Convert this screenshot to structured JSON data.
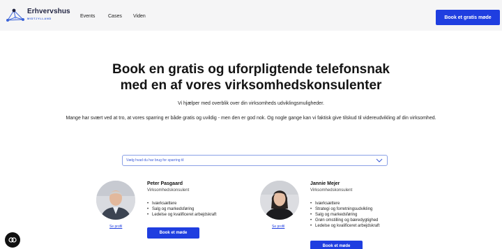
{
  "header": {
    "logo_title": "Erhvervshus",
    "logo_subtitle": "MIDTJYLLAND",
    "nav": [
      {
        "label": "Events"
      },
      {
        "label": "Cases"
      },
      {
        "label": "Viden"
      }
    ],
    "cta_label": "Book et gratis møde"
  },
  "hero": {
    "title_line1": "Book en gratis og uforpligtende telefonsnak",
    "title_line2": "med en af vores virksomhedskonsulenter",
    "subtitle": "Vi hjælper med overblik over din virksomheds udviklingsmuligheder.",
    "text": "Mange har svært ved at tro, at vores sparring er både gratis og uvildig - men den er god nok. Og nogle gange kan vi faktisk give tilskud til videreudvikling af din virksomhed."
  },
  "filter": {
    "selected": "Vælg hvad du har brug for sparring til"
  },
  "consultants": [
    {
      "name": "Peter Pasgaard",
      "role": "Virksomhedskonsulent",
      "skills": [
        "Iværksættere",
        "Salg og markedsføring",
        "Ledelse og kvalificeret arbejdskraft"
      ],
      "profile_link": "Se profil",
      "button": "Book et møde"
    },
    {
      "name": "Jannie Mejer",
      "role": "Virksomhedskonsulent",
      "skills": [
        "Iværksættere",
        "Strategi og forretningsudvikling",
        "Salg og markedsføring",
        "Grøn omstilling og bæredygtighed",
        "Ledelse og kvalificeret arbejdskraft"
      ],
      "profile_link": "Se profil",
      "button": "Book et møde"
    }
  ],
  "colors": {
    "accent": "#1f3ee0",
    "header_bg": "#f5f5f6",
    "brand_dark": "#1f2240"
  },
  "icons": {
    "logo": "network-nodes-icon",
    "select": "chevron-down-icon",
    "chat": "chat-bubble-icon"
  }
}
